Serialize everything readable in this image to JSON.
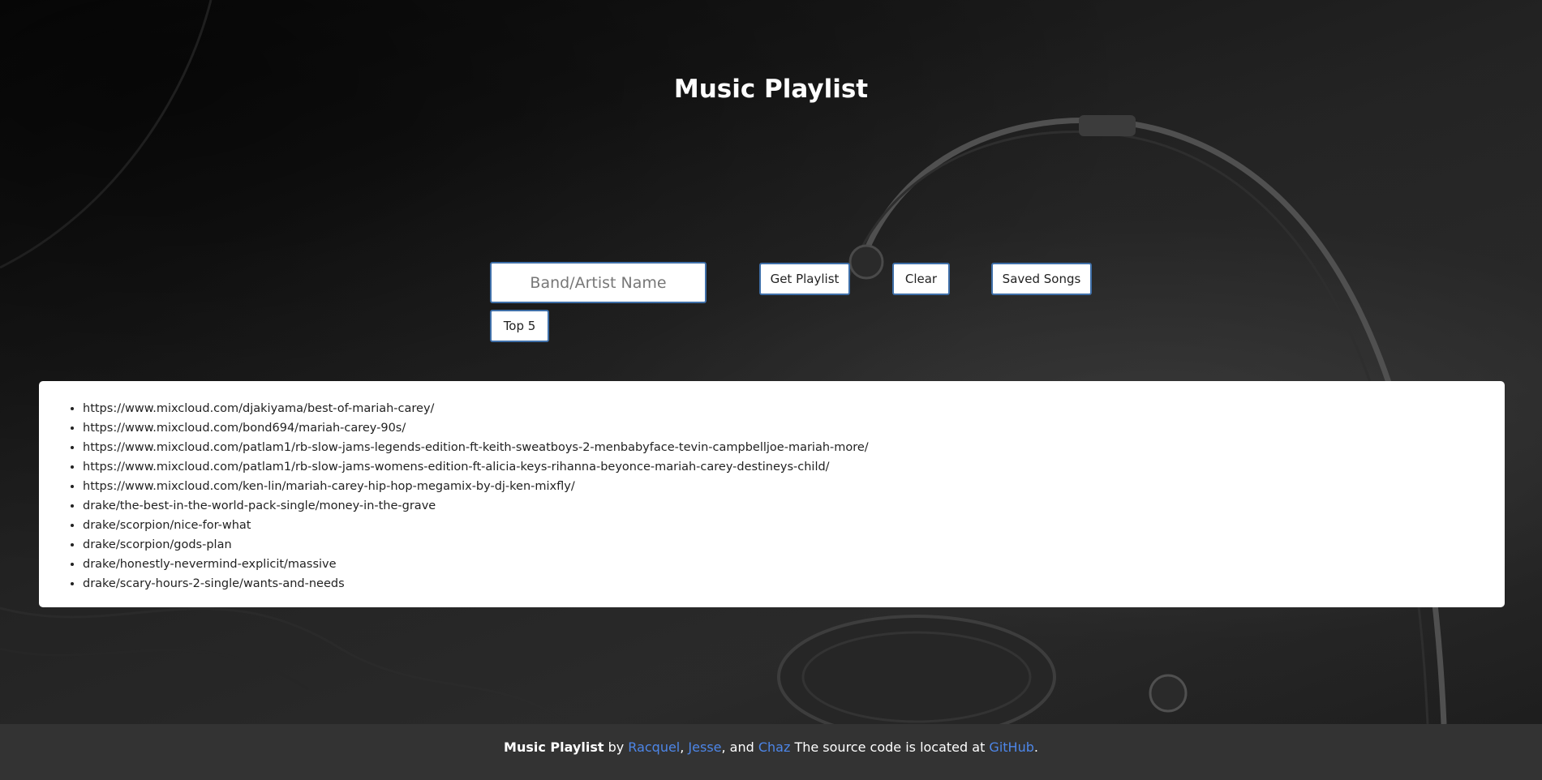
{
  "page": {
    "title": "Music Playlist"
  },
  "search": {
    "placeholder": "Band/Artist Name",
    "value": ""
  },
  "buttons": {
    "get_playlist": "Get Playlist",
    "clear": "Clear",
    "saved_songs": "Saved Songs",
    "top5": "Top 5"
  },
  "results": {
    "items": [
      "https://www.mixcloud.com/djakiyama/best-of-mariah-carey/",
      "https://www.mixcloud.com/bond694/mariah-carey-90s/",
      "https://www.mixcloud.com/patlam1/rb-slow-jams-legends-edition-ft-keith-sweatboys-2-menbabyface-tevin-campbelljoe-mariah-more/",
      "https://www.mixcloud.com/patlam1/rb-slow-jams-womens-edition-ft-alicia-keys-rihanna-beyonce-mariah-carey-destineys-child/",
      "https://www.mixcloud.com/ken-lin/mariah-carey-hip-hop-megamix-by-dj-ken-mixfly/",
      "drake/the-best-in-the-world-pack-single/money-in-the-grave",
      "drake/scorpion/nice-for-what",
      "drake/scorpion/gods-plan",
      "drake/honestly-nevermind-explicit/massive",
      "drake/scary-hours-2-single/wants-and-needs"
    ]
  },
  "footer": {
    "app_name": "Music Playlist",
    "by": " by ",
    "author1": "Racquel",
    "sep1": ", ",
    "author2": "Jesse",
    "sep2": ", and ",
    "author3": "Chaz",
    "source_text": " The source code is located at ",
    "source_link": "GitHub",
    "end": "."
  },
  "colors": {
    "button_border": "#3f6fa8",
    "link": "#4d86e8",
    "footer_bg": "#333333"
  }
}
